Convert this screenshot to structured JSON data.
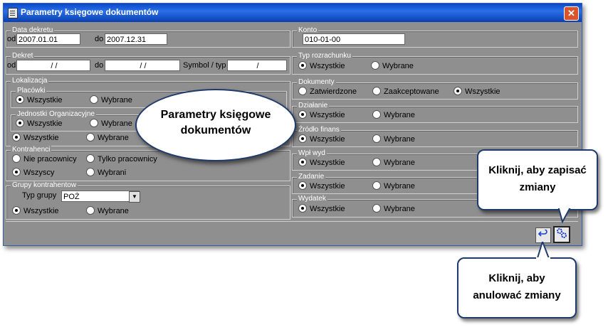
{
  "window": {
    "title": "Parametry księgowe dokumentów",
    "close_label": "✕"
  },
  "data_dekretu": {
    "legend": "Data dekretu",
    "od_label": "od",
    "od_value": "2007.01.01",
    "do_label": "do",
    "do_value": "2007.12.31"
  },
  "konto": {
    "legend": "Konto",
    "value": "010-01-00"
  },
  "dekret": {
    "legend": "Dekret",
    "od_label": "od",
    "od_value": "/ /",
    "do_label": "do",
    "do_value": "/ /",
    "symbol_label": "Symbol / typ",
    "symbol_value": "/"
  },
  "typ_rozrachunku": {
    "legend": "Typ rozrachunku",
    "options": [
      "Wszystkie",
      "Wybrane"
    ]
  },
  "lokalizacja": {
    "legend": "Lokalizacja"
  },
  "placowki": {
    "legend": "Placówki",
    "options": [
      "Wszystkie",
      "Wybrane"
    ]
  },
  "jednostki": {
    "legend": "Jednostki Organizacyjne",
    "options": [
      "Wszystkie",
      "Wybrane"
    ]
  },
  "lokalizacja_radio": {
    "options": [
      "Wszystkie",
      "Wybrane"
    ]
  },
  "dokumenty": {
    "legend": "Dokumenty",
    "options": [
      "Zatwierdzone",
      "Zaakceptowane",
      "Wszystkie"
    ]
  },
  "dzialanie": {
    "legend": "Działanie",
    "options": [
      "Wszystkie",
      "Wybrane"
    ]
  },
  "zrodlo": {
    "legend": "Źródło finans",
    "options": [
      "Wszystkie",
      "Wybrane"
    ]
  },
  "kontrahenci": {
    "legend": "Kontrahenci",
    "options": [
      "Nie pracownicy",
      "Tylko pracownicy",
      "Wszyscy",
      "Wybrani"
    ]
  },
  "wpl_wyd": {
    "legend": "Wpł  wyd",
    "options": [
      "Wszystkie",
      "Wybrane"
    ]
  },
  "zadanie": {
    "legend": "Zadanie",
    "options": [
      "Wszystkie",
      "Wybrane"
    ]
  },
  "grupy": {
    "legend": "Grupy kontrahentow",
    "typ_label": "Typ grupy",
    "typ_value": "POŻ",
    "options": [
      "Wszystkie",
      "Wybrane"
    ]
  },
  "wydatek": {
    "legend": "Wydatek",
    "options": [
      "Wszystkie",
      "Wybrane"
    ]
  },
  "callouts": {
    "center": "Parametry księgowe dokumentów",
    "save": "Kliknij, aby zapisać zmiany",
    "cancel": "Kliknij, aby anulować zmiany"
  },
  "toolbar": {
    "undo_icon": "undo-icon",
    "save_icon": "gears-icon"
  }
}
